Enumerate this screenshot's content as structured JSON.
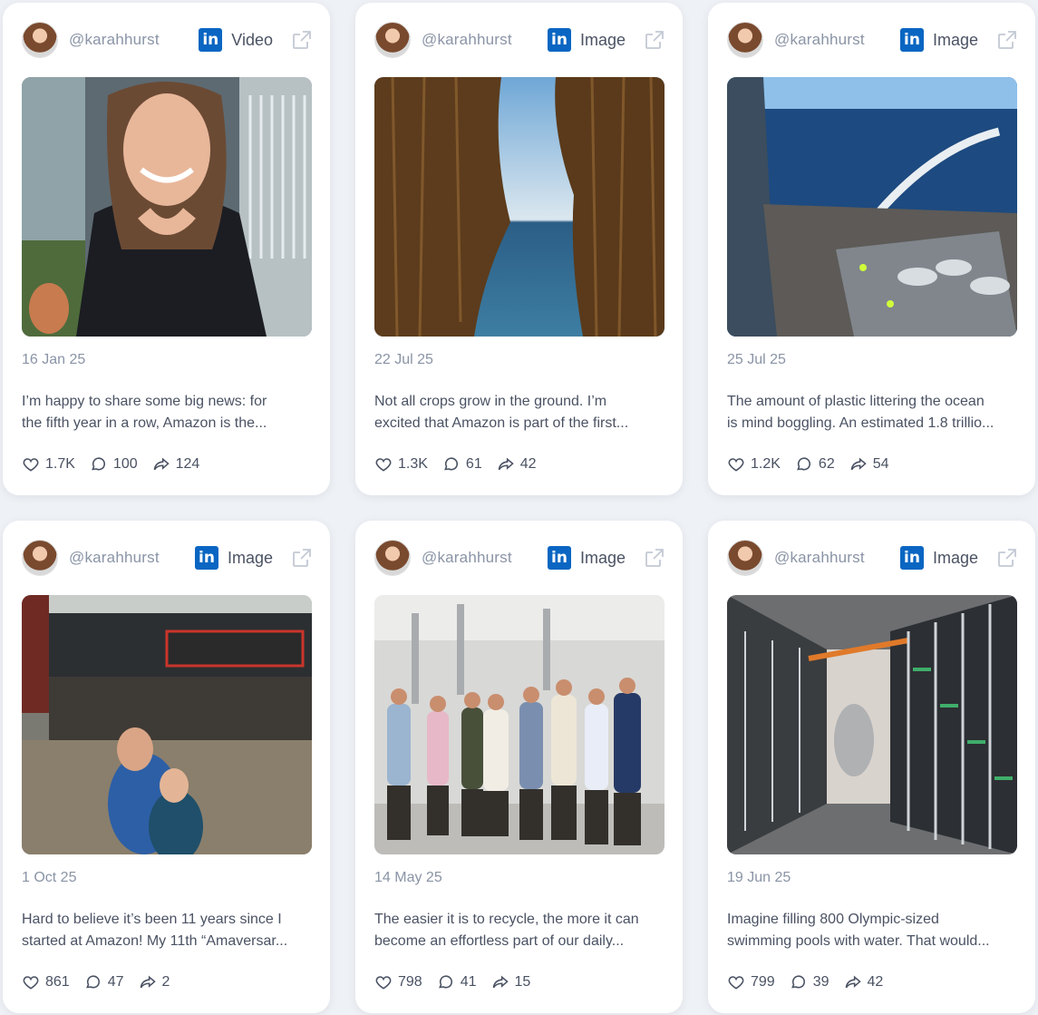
{
  "posts": [
    {
      "handle": "@karahhurst",
      "type": "Video",
      "date": "16 Jan 25",
      "caption_line1": "I’m happy to share some big news: for",
      "caption_line2": "the fifth year in a row, Amazon is the...",
      "likes": "1.7K",
      "comments": "100",
      "shares": "124"
    },
    {
      "handle": "@karahhurst",
      "type": "Image",
      "date": "22 Jul 25",
      "caption_line1": "Not all crops grow in the ground. I’m",
      "caption_line2": "excited that Amazon is part of the first...",
      "likes": "1.3K",
      "comments": "61",
      "shares": "42"
    },
    {
      "handle": "@karahhurst",
      "type": "Image",
      "date": "25 Jul 25",
      "caption_line1": "The amount of plastic littering the ocean",
      "caption_line2": "is mind boggling. An estimated 1.8 trillio...",
      "likes": "1.2K",
      "comments": "62",
      "shares": "54"
    },
    {
      "handle": "@karahhurst",
      "type": "Image",
      "date": "1 Oct 25",
      "caption_line1": "Hard to believe it’s been 11 years since I",
      "caption_line2": "started at Amazon! My 11th “Amaversar...",
      "likes": "861",
      "comments": "47",
      "shares": "2"
    },
    {
      "handle": "@karahhurst",
      "type": "Image",
      "date": "14 May 25",
      "caption_line1": "The easier it is to recycle, the more it can",
      "caption_line2": "become an effortless part of our daily...",
      "likes": "798",
      "comments": "41",
      "shares": "15"
    },
    {
      "handle": "@karahhurst",
      "type": "Image",
      "date": "19 Jun 25",
      "caption_line1": "Imagine filling 800 Olympic-sized",
      "caption_line2": "swimming pools with water. That would...",
      "likes": "799",
      "comments": "39",
      "shares": "42"
    }
  ],
  "icons": {
    "platform": "linkedin-icon",
    "external": "external-link-icon",
    "like": "heart-icon",
    "comment": "comment-icon",
    "share": "share-icon"
  },
  "colors": {
    "linkedin": "#0a66c2",
    "text_muted": "#8a94a6",
    "text": "#4a5263",
    "background": "#eef1f5"
  }
}
